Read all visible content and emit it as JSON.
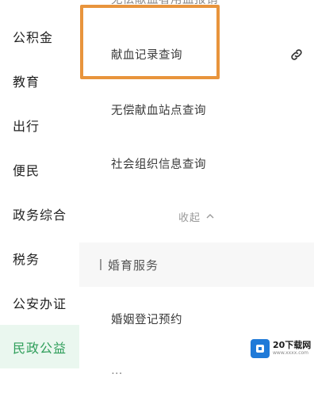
{
  "sidebar": {
    "items": [
      {
        "label": "公积金"
      },
      {
        "label": "教育"
      },
      {
        "label": "出行"
      },
      {
        "label": "便民"
      },
      {
        "label": "政务综合"
      },
      {
        "label": "税务"
      },
      {
        "label": "公安办证"
      },
      {
        "label": "民政公益"
      }
    ],
    "active_index": 7
  },
  "content": {
    "partial_top_label": "无偿献血者用血报销",
    "items": [
      {
        "label": "献血记录查询"
      },
      {
        "label": "无偿献血站点查询"
      },
      {
        "label": "社会组织信息查询"
      }
    ],
    "collapse_label": "收起",
    "section_title": "婚育服务",
    "section_items": [
      {
        "label": "婚姻登记预约"
      }
    ],
    "partial_bottom_label": "…"
  },
  "watermark": {
    "brand": "20下载网",
    "url": "www.xxxx.com"
  },
  "colors": {
    "accent_green": "#2f9e5a",
    "active_bg": "#eaf7ef",
    "highlight_orange": "#e8943c"
  },
  "icons": {
    "link": "link-icon",
    "collapse": "chevron-up-icon"
  }
}
